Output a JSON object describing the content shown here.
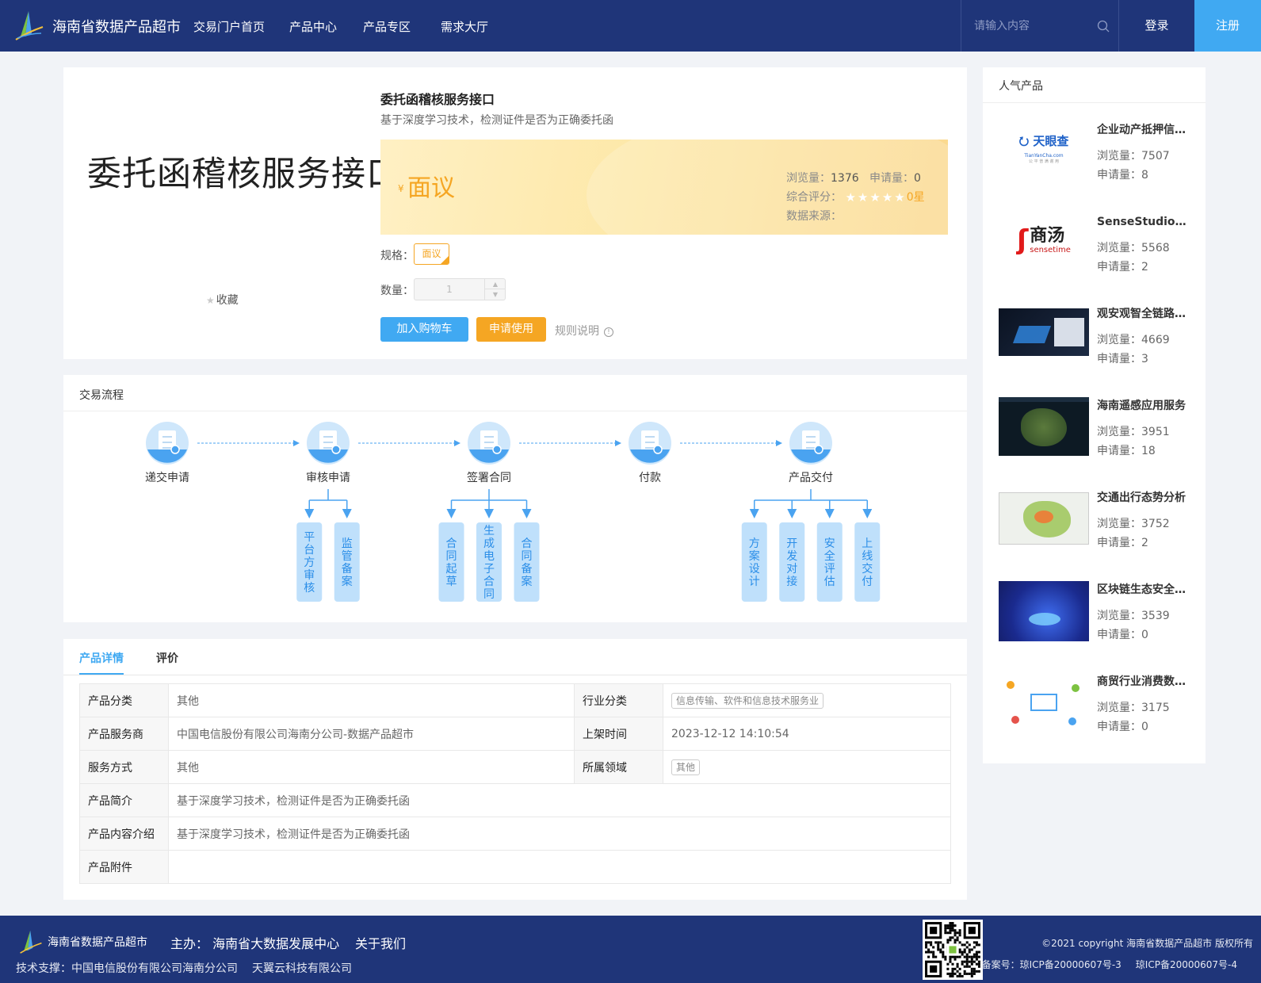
{
  "header": {
    "site_name": "海南省数据产品超市",
    "nav": [
      "交易门户首页",
      "产品中心",
      "产品专区",
      "需求大厅"
    ],
    "search_placeholder": "请输入内容",
    "login": "登录",
    "register": "注册"
  },
  "product": {
    "image_text": "委托函稽核服务接口",
    "favorite": "收藏",
    "title": "委托函稽核服务接口",
    "subtitle": "基于深度学习技术，检测证件是否为正确委托函",
    "currency": "¥",
    "price": "面议",
    "views_label": "浏览量：",
    "views": "1376",
    "applies_label": "申请量：",
    "applies": "0",
    "rating_label": "综合评分：",
    "rating": "0星",
    "rating_value": 0,
    "rating_max": 5,
    "source_label": "数据来源：",
    "spec_label": "规格：",
    "spec_value": "面议",
    "qty_label": "数量：",
    "qty_value": "1",
    "add_cart": "加入购物车",
    "apply_use": "申请使用",
    "rules": "规则说明"
  },
  "flow": {
    "title": "交易流程",
    "steps": [
      {
        "label": "递交申请",
        "subs": []
      },
      {
        "label": "审核申请",
        "subs": [
          "平台方审核",
          "监管备案"
        ]
      },
      {
        "label": "签署合同",
        "subs": [
          "合同起草",
          "生成电子合同",
          "合同备案"
        ]
      },
      {
        "label": "付款",
        "subs": []
      },
      {
        "label": "产品交付",
        "subs": [
          "方案设计",
          "开发对接",
          "安全评估",
          "上线交付"
        ]
      }
    ],
    "colors": {
      "accent": "#4aa3f0",
      "light": "#cfe7fb",
      "sub_box": "#bfe0fb",
      "sub_text": "#2b8ee8"
    }
  },
  "details": {
    "tabs": [
      "产品详情",
      "评价"
    ],
    "rows": [
      {
        "k1": "产品分类",
        "v1": "其他",
        "k2": "行业分类",
        "v2": "信息传输、软件和信息技术服务业"
      },
      {
        "k1": "产品服务商",
        "v1": "中国电信股份有限公司海南分公司-数据产品超市",
        "k2": "上架时间",
        "v2": "2023-12-12 14:10:54"
      },
      {
        "k1": "服务方式",
        "v1": "其他",
        "k2": "所属领域",
        "v2": "其他"
      }
    ],
    "full_rows": [
      {
        "k": "产品简介",
        "v": "基于深度学习技术，检测证件是否为正确委托函"
      },
      {
        "k": "产品内容介绍",
        "v": "基于深度学习技术，检测证件是否为正确委托函"
      },
      {
        "k": "产品附件",
        "v": ""
      }
    ]
  },
  "popular": {
    "title": "人气产品",
    "items": [
      {
        "name": "企业动产抵押信息查询",
        "views": "浏览量：7507",
        "applies": "申请量：8",
        "thumb": "tianyancha",
        "logo_text": "天眼查",
        "logo_sub": "TianYanCha.com",
        "logo_tag": "公 平 普 满 谢 用"
      },
      {
        "name": "SenseStudio智能平台",
        "views": "浏览量：5568",
        "applies": "申请量：2",
        "thumb": "sensetime",
        "logo_text": "商汤",
        "logo_sub": "sensetime"
      },
      {
        "name": "观安观智全链路数据安全",
        "views": "浏览量：4669",
        "applies": "申请量：3",
        "thumb": "dark-ui"
      },
      {
        "name": "海南遥感应用服务",
        "views": "浏览量：3951",
        "applies": "申请量：18",
        "thumb": "satellite"
      },
      {
        "name": "交通出行态势分析",
        "views": "浏览量：3752",
        "applies": "申请量：2",
        "thumb": "map"
      },
      {
        "name": "区块链生态安全服务",
        "views": "浏览量：3539",
        "applies": "申请量：0",
        "thumb": "blockchain"
      },
      {
        "name": "商贸行业消费数据分析",
        "views": "浏览量：3175",
        "applies": "申请量：0",
        "thumb": "network"
      }
    ]
  },
  "footer": {
    "site_name": "海南省数据产品超市",
    "host": "主办： 海南省大数据发展中心",
    "about": "关于我们",
    "tech": [
      "技术支撑：中国电信股份有限公司海南分公司",
      "天翼云科技有限公司"
    ],
    "copyright": "©2021 copyright 海南省数据产品超市 版权所有",
    "icp": [
      "备案号：琼ICP备20000607号-3",
      "琼ICP备20000607号-4"
    ]
  },
  "colors": {
    "header_bg": "#1f3579",
    "accent_blue": "#40a9f2",
    "accent_orange": "#f5a623",
    "page_bg": "#f1f3f7"
  }
}
